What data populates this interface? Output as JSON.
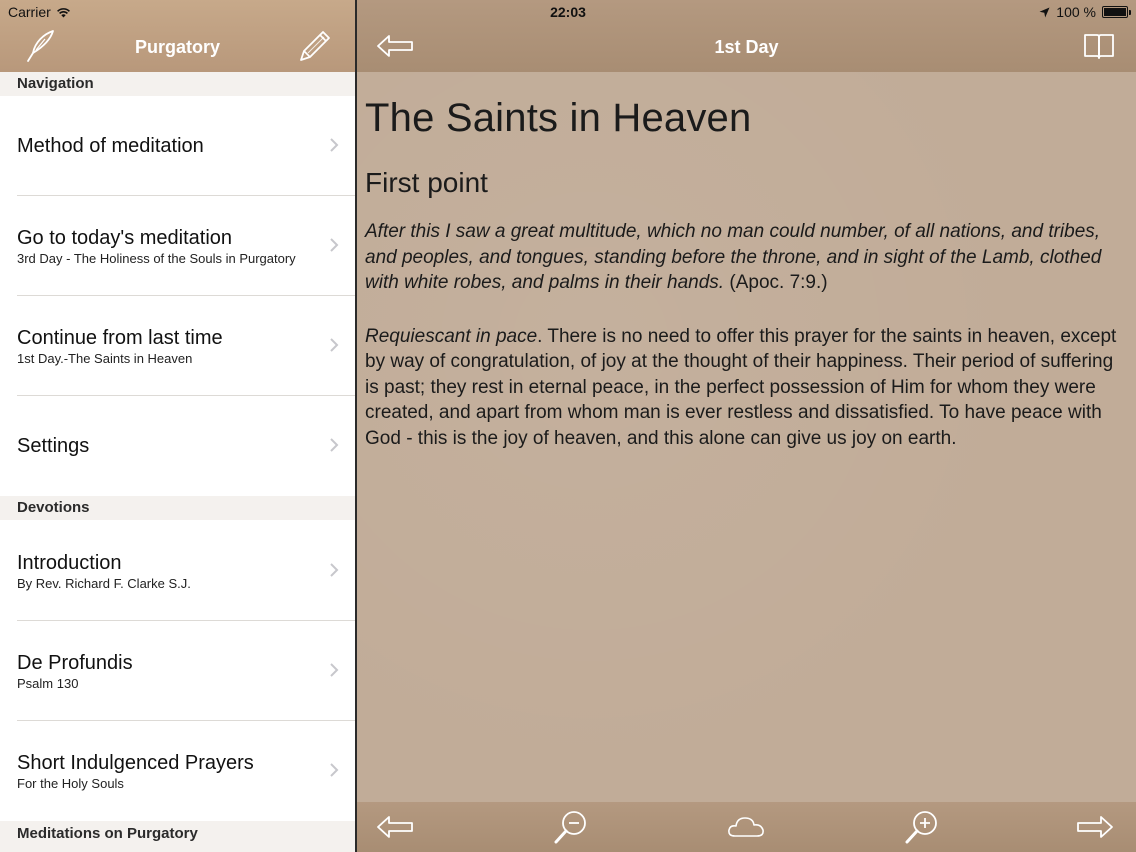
{
  "status": {
    "carrier": "Carrier",
    "time": "22:03",
    "battery": "100 %"
  },
  "master": {
    "title": "Purgatory",
    "sections": [
      {
        "header": "Navigation",
        "rows": [
          {
            "label": "Method of meditation",
            "sub": ""
          },
          {
            "label": "Go to today's meditation",
            "sub": "3rd Day - The Holiness of the Souls in Purgatory"
          },
          {
            "label": "Continue from last time",
            "sub": "1st Day.-The Saints in Heaven"
          },
          {
            "label": "Settings",
            "sub": ""
          }
        ]
      },
      {
        "header": "Devotions",
        "rows": [
          {
            "label": "Introduction",
            "sub": "By Rev. Richard F. Clarke S.J."
          },
          {
            "label": "De Profundis",
            "sub": "Psalm 130"
          },
          {
            "label": "Short Indulgenced Prayers",
            "sub": "For the Holy Souls"
          }
        ]
      },
      {
        "header": "Meditations on Purgatory",
        "rows": []
      }
    ]
  },
  "detail": {
    "title": "1st Day",
    "heading": "The Saints in Heaven",
    "subheading": "First point",
    "quote": "After this I saw a great multitude, which no man could number, of all nations, and tribes, and peoples, and tongues, standing before the throne, and in sight of the Lamb, clothed with white robes, and palms in their hands.",
    "quote_ref": " (Apoc. 7:9.)",
    "para_italic": "Requiescant in pace",
    "para_body": ". There is no need to offer this prayer for the saints in heaven, except by way of congratulation, of joy at the thought of their happiness. Their period of suffering is past; they rest in eternal peace, in the perfect possession of Him for whom they were created, and apart from whom man is ever restless and dissatisfied. To have peace with God - this is the joy of heaven, and this alone can give us joy on earth."
  },
  "icons": {
    "quill": "quill-icon",
    "edit": "pencil-icon",
    "back": "back-arrow-icon",
    "book": "book-icon",
    "zoom_out": "zoom-out-icon",
    "cloud": "cloud-icon",
    "zoom_in": "zoom-in-icon",
    "forward": "forward-arrow-icon"
  }
}
